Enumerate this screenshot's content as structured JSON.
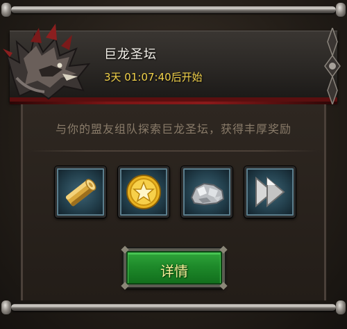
{
  "event": {
    "title": "巨龙圣坛",
    "countdown": "3天 01:07:40后开始",
    "description": "与你的盟友组队探索巨龙圣坛，获得丰厚奖励"
  },
  "rewards": [
    {
      "icon": "wood-log-icon"
    },
    {
      "icon": "gold-coin-star-icon"
    },
    {
      "icon": "silver-ore-icon"
    },
    {
      "icon": "double-arrow-icon"
    }
  ],
  "details_button": {
    "label": "详情"
  },
  "colors": {
    "title": "#f4f1ea",
    "countdown": "#f2d24a",
    "description": "#8a7c6a",
    "button_green": "#1e8a2a",
    "button_text": "#f6f09a",
    "slot_blue": "#2c4a57"
  }
}
